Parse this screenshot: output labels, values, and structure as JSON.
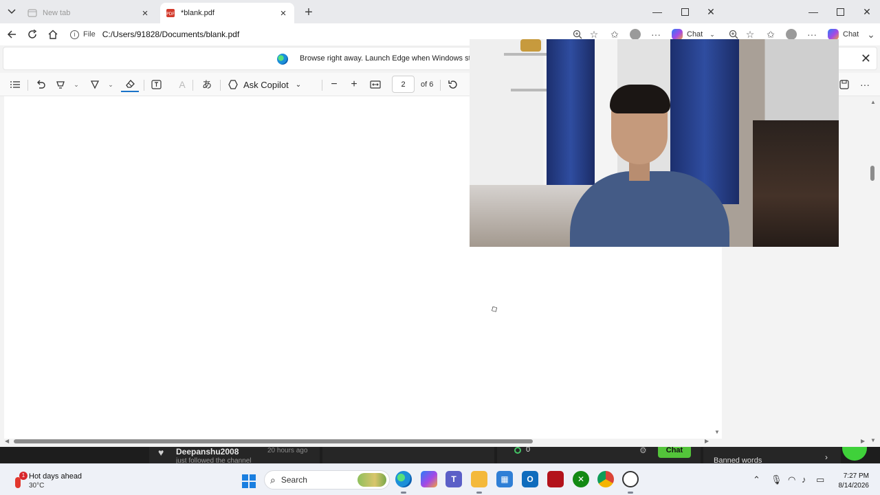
{
  "browser": {
    "tabs": [
      {
        "title": "New tab",
        "active": false
      },
      {
        "title": "*blank.pdf",
        "active": true
      }
    ],
    "address": {
      "scheme": "File",
      "url": "C:/Users/91828/Documents/blank.pdf"
    },
    "chat_label": "Chat",
    "chat_label_2": "Chat"
  },
  "notification": {
    "message": "Browse right away. Launch Edge when Windows starts."
  },
  "pdf_toolbar": {
    "ask_copilot_label": "Ask Copilot",
    "page_current": "2",
    "page_total_label": "of 6",
    "translate_glyph": "あ",
    "text_glyph": "A"
  },
  "stream_overlay": {
    "follower_name": "Deepanshu2008",
    "follower_time": "20 hours ago",
    "follower_subtext": "just followed the channel",
    "viewer_count": "0",
    "chat_button": "Chat",
    "banned_words": "Banned words"
  },
  "taskbar": {
    "weather_title": "Hot days ahead",
    "weather_temp": "30°C",
    "weather_badge": "1",
    "search_label": "Search",
    "time": "7:27 PM",
    "date": "8/14/2026"
  },
  "colors": {
    "accent": "#1a73c9",
    "taskbar_bg": "#eef1f7",
    "chat_green": "#53c43a"
  }
}
